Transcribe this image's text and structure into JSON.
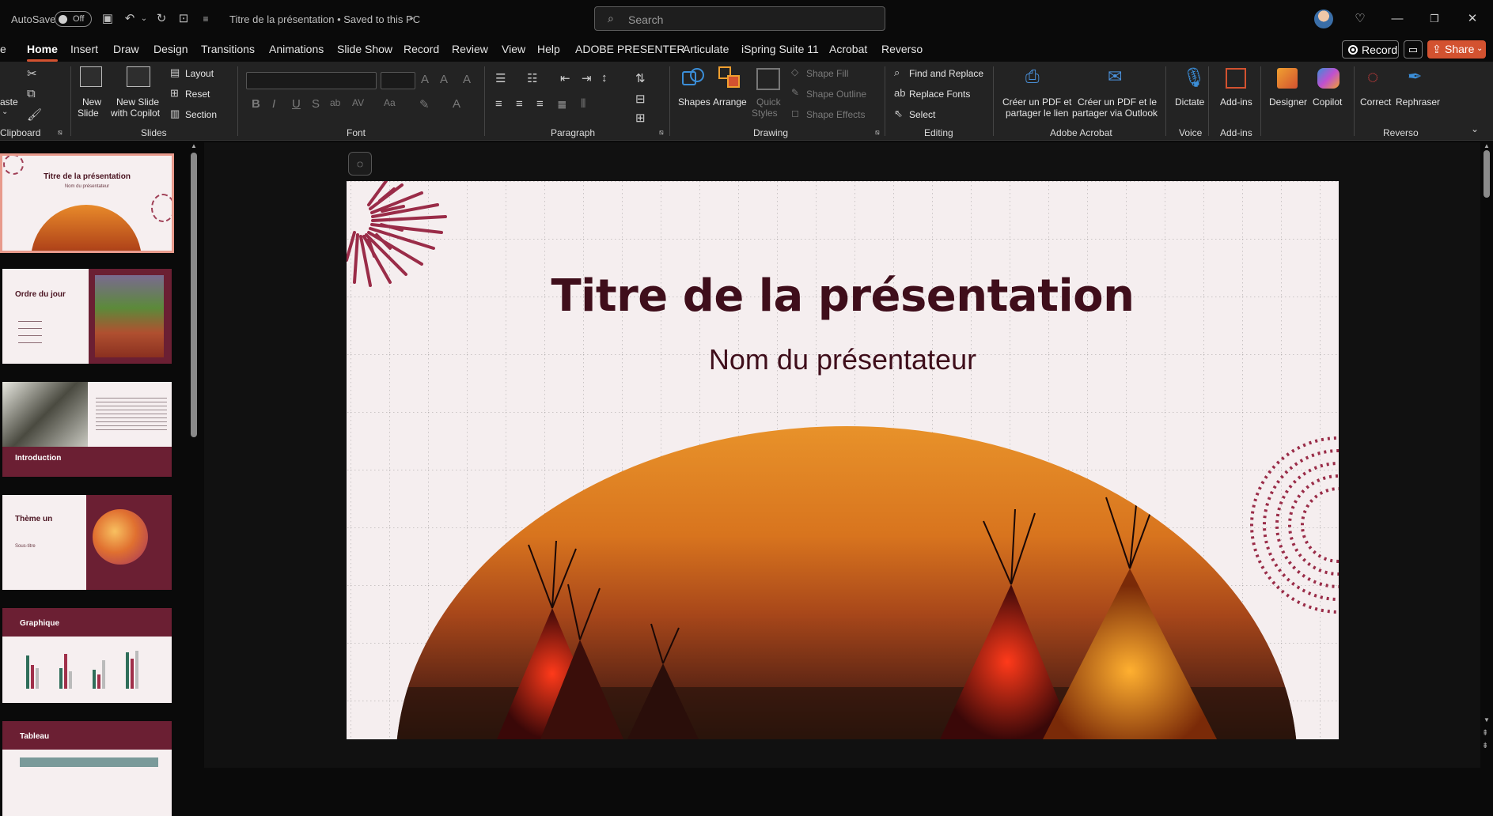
{
  "titlebar": {
    "autosave_label": "AutoSave",
    "autosave_state": "Off",
    "doc_title": "Titre de la présentation • Saved to this PC",
    "search_placeholder": "Search"
  },
  "tabs": [
    "Home",
    "Insert",
    "Draw",
    "Design",
    "Transitions",
    "Animations",
    "Slide Show",
    "Record",
    "Review",
    "View",
    "Help",
    "ADOBE PRESENTER",
    "Articulate",
    "iSpring Suite 11",
    "Acrobat",
    "Reverso"
  ],
  "active_tab": "Home",
  "partial_tab": "e",
  "actions": {
    "record": "Record",
    "share": "Share"
  },
  "ribbon": {
    "clipboard": {
      "paste": "aste",
      "group": "Clipboard"
    },
    "slides": {
      "new_slide": "New",
      "new_slide2": "Slide",
      "new_copilot": "New Slide",
      "new_copilot2": "with Copilot",
      "layout": "Layout",
      "reset": "Reset",
      "section": "Section",
      "group": "Slides"
    },
    "font": {
      "group": "Font",
      "font_name": "",
      "font_size": ""
    },
    "paragraph": {
      "group": "Paragraph"
    },
    "drawing": {
      "shapes": "Shapes",
      "arrange": "Arrange",
      "quick": "Quick",
      "styles": "Styles",
      "shape_fill": "Shape Fill",
      "shape_outline": "Shape Outline",
      "shape_effects": "Shape Effects",
      "group": "Drawing"
    },
    "editing": {
      "find": "Find and Replace",
      "replace_fonts": "Replace Fonts",
      "select": "Select",
      "group": "Editing"
    },
    "acrobat": {
      "btn1a": "Créer un PDF et",
      "btn1b": "partager le lien",
      "btn2a": "Créer un PDF et le",
      "btn2b": "partager via Outlook",
      "group": "Adobe Acrobat"
    },
    "voice": {
      "dictate": "Dictate",
      "group": "Voice"
    },
    "addins": {
      "addins": "Add-ins",
      "group": "Add-ins"
    },
    "misc": {
      "designer": "Designer",
      "copilot": "Copilot"
    },
    "reverso": {
      "correct": "Correct",
      "rephraser": "Rephraser",
      "group": "Reverso"
    }
  },
  "thumbnails": [
    {
      "title": "Titre de la présentation",
      "subtitle": "Nom du présentateur"
    },
    {
      "title": "Ordre du jour"
    },
    {
      "title": "Introduction"
    },
    {
      "title": "Thème un",
      "subtitle": "Sous-titre"
    },
    {
      "title": "Graphique"
    },
    {
      "title": "Tableau"
    }
  ],
  "slide": {
    "title": "Titre de la présentation",
    "subtitle": "Nom du présentateur"
  },
  "colors": {
    "accent": "#d35230",
    "slide_title": "#3f0e1b",
    "theme_maroon": "#6b1f33"
  }
}
